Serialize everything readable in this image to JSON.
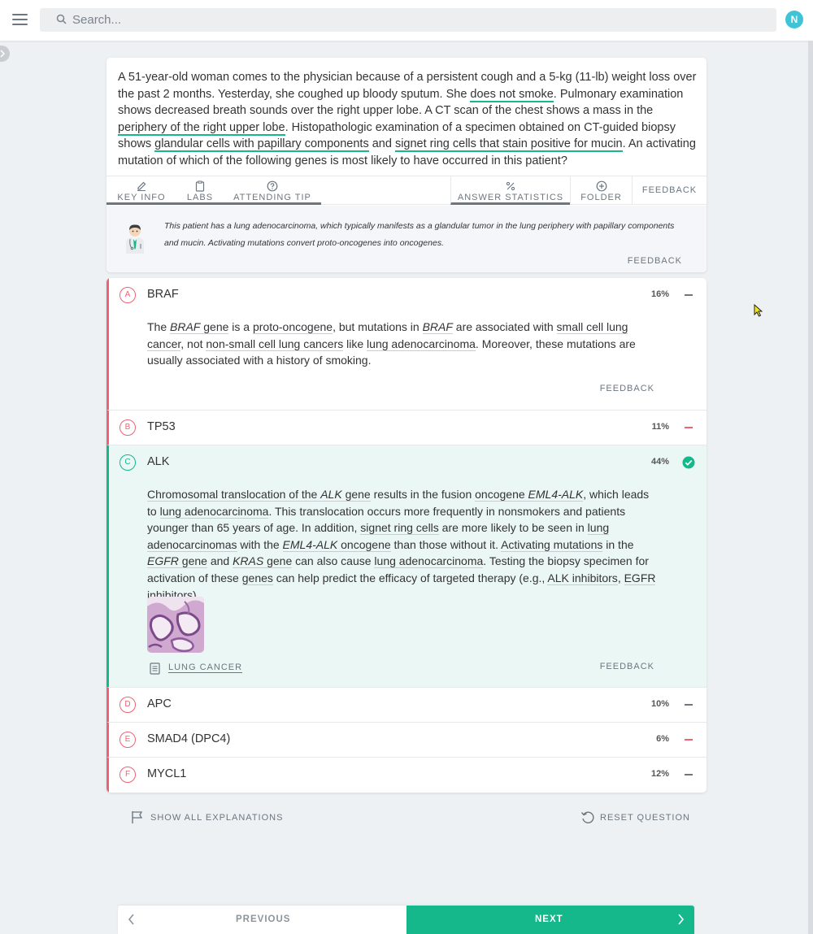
{
  "header": {
    "search_placeholder": "Search...",
    "avatar_initial": "N"
  },
  "question": {
    "segments": [
      {
        "text": "A 51-year-old woman comes to the physician because of a persistent cough and a 5-kg (11-lb) weight loss over the past 2 months. Yesterday, she coughed up bloody sputum. She ",
        "hl": false
      },
      {
        "text": "does not smoke",
        "hl": true
      },
      {
        "text": ". Pulmonary examination shows decreased breath sounds over the right upper lobe. A CT scan of the chest shows a mass in the ",
        "hl": false
      },
      {
        "text": "periphery of the right upper lobe",
        "hl": true
      },
      {
        "text": ". Histopathologic examination of a specimen obtained on CT-guided biopsy shows ",
        "hl": false
      },
      {
        "text": "glandular cells with papillary components",
        "hl": true
      },
      {
        "text": " and ",
        "hl": false
      },
      {
        "text": "signet ring cells that stain positive for mucin",
        "hl": true
      },
      {
        "text": ". An activating mutation of which of the following genes is most likely to have occurred in this patient?",
        "hl": false
      }
    ]
  },
  "tabs": {
    "key_info": "KEY INFO",
    "labs": "LABS",
    "attending_tip": "ATTENDING TIP",
    "answer_statistics": "ANSWER STATISTICS",
    "folder": "FOLDER",
    "feedback": "FEEDBACK"
  },
  "tip": {
    "text": "This patient has a lung adenocarcinoma, which typically manifests as a glandular tumor in the lung periphery with papillary components and mucin. Activating mutations convert proto-oncogenes into oncogenes.",
    "feedback": "FEEDBACK"
  },
  "answers": [
    {
      "letter": "A",
      "text": "BRAF",
      "pct": "16%",
      "status": "wrong"
    },
    {
      "letter": "B",
      "text": "TP53",
      "pct": "11%",
      "status": "wrong"
    },
    {
      "letter": "C",
      "text": "ALK",
      "pct": "44%",
      "status": "correct"
    },
    {
      "letter": "D",
      "text": "APC",
      "pct": "10%",
      "status": "wrong"
    },
    {
      "letter": "E",
      "text": "SMAD4 (DPC4)",
      "pct": "6%",
      "status": "wrong"
    },
    {
      "letter": "F",
      "text": "MYCL1",
      "pct": "12%",
      "status": "wrong"
    }
  ],
  "explanation_a": {
    "segments": [
      {
        "text": "The ",
        "u": false,
        "i": false
      },
      {
        "text": "BRAF",
        "u": true,
        "i": true
      },
      {
        "text": " gene",
        "u": true,
        "i": false
      },
      {
        "text": " is a ",
        "u": false,
        "i": false
      },
      {
        "text": "proto-oncogene",
        "u": true,
        "i": false
      },
      {
        "text": ", but mutations in ",
        "u": false,
        "i": false
      },
      {
        "text": "BRAF",
        "u": true,
        "i": true
      },
      {
        "text": " are associated with ",
        "u": false,
        "i": false
      },
      {
        "text": "small cell lung cancer",
        "u": true,
        "i": false
      },
      {
        "text": ", not ",
        "u": false,
        "i": false
      },
      {
        "text": "non-small cell lung cancers",
        "u": true,
        "i": false
      },
      {
        "text": " like ",
        "u": false,
        "i": false
      },
      {
        "text": "lung adenocarcinoma",
        "u": true,
        "i": false
      },
      {
        "text": ". Moreover, these mutations are usually associated with a history of smoking.",
        "u": false,
        "i": false
      }
    ],
    "feedback": "FEEDBACK"
  },
  "explanation_c": {
    "segments": [
      {
        "text": "Chromosomal translocation of the ",
        "u": true,
        "i": false
      },
      {
        "text": "ALK",
        "u": true,
        "i": true
      },
      {
        "text": " gene",
        "u": true,
        "i": false
      },
      {
        "text": " results in the fusion ",
        "u": false,
        "i": false
      },
      {
        "text": "oncogene ",
        "u": true,
        "i": false
      },
      {
        "text": "EML4-ALK",
        "u": true,
        "i": true
      },
      {
        "text": ", which leads to ",
        "u": false,
        "i": false
      },
      {
        "text": "lung adenocarcinoma",
        "u": true,
        "i": false
      },
      {
        "text": ". This translocation occurs more frequently in nonsmokers and patients younger than 65 years of age. In addition, ",
        "u": false,
        "i": false
      },
      {
        "text": "signet ring cells",
        "u": true,
        "i": false
      },
      {
        "text": " are more likely to be seen in ",
        "u": false,
        "i": false
      },
      {
        "text": "lung adenocarcinomas",
        "u": true,
        "i": false
      },
      {
        "text": " with the ",
        "u": false,
        "i": false
      },
      {
        "text": "EML4-ALK",
        "u": true,
        "i": true
      },
      {
        "text": " oncogene",
        "u": true,
        "i": false
      },
      {
        "text": " than those without it. ",
        "u": false,
        "i": false
      },
      {
        "text": "Activating mutations",
        "u": true,
        "i": false
      },
      {
        "text": " in the ",
        "u": false,
        "i": false
      },
      {
        "text": "EGFR",
        "u": true,
        "i": true
      },
      {
        "text": " gene",
        "u": true,
        "i": false
      },
      {
        "text": " and ",
        "u": false,
        "i": false
      },
      {
        "text": "KRAS",
        "u": true,
        "i": true
      },
      {
        "text": " gene",
        "u": true,
        "i": false
      },
      {
        "text": " can also cause ",
        "u": false,
        "i": false
      },
      {
        "text": "lung adenocarcinoma",
        "u": true,
        "i": false
      },
      {
        "text": ". Testing the biopsy specimen for activation of these ",
        "u": false,
        "i": false
      },
      {
        "text": "genes",
        "u": true,
        "i": false
      },
      {
        "text": " can help predict the efficacy of targeted therapy (e.g., ",
        "u": false,
        "i": false
      },
      {
        "text": "ALK inhibitors",
        "u": true,
        "i": false
      },
      {
        "text": ", ",
        "u": false,
        "i": false
      },
      {
        "text": "EGFR inhibitors",
        "u": true,
        "i": false
      },
      {
        "text": ").",
        "u": false,
        "i": false
      }
    ],
    "article_label": "LUNG CANCER",
    "feedback": "FEEDBACK"
  },
  "bottom": {
    "show_all": "SHOW ALL EXPLANATIONS",
    "reset": "RESET QUESTION",
    "previous": "PREVIOUS",
    "next": "NEXT"
  },
  "colors": {
    "accent_green": "#14b88a",
    "wrong_red": "#ef6272",
    "avatar_teal": "#3fc3d7"
  }
}
